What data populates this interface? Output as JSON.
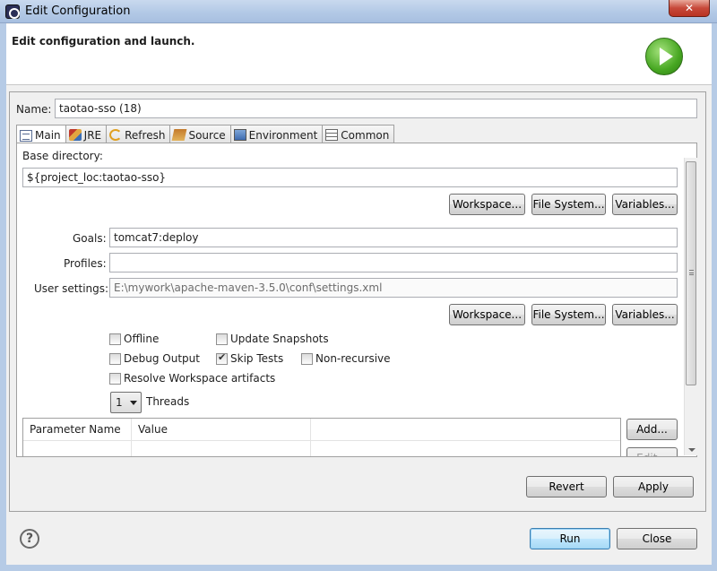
{
  "window": {
    "title": "Edit Configuration",
    "close_symbol": "✕"
  },
  "banner": {
    "text": "Edit configuration and launch."
  },
  "config": {
    "name_label": "Name:",
    "name_value": "taotao-sso (18)",
    "tabs": [
      {
        "label": "Main",
        "icon": "main-tab-icon"
      },
      {
        "label": "JRE",
        "icon": "jre-icon"
      },
      {
        "label": "Refresh",
        "icon": "refresh-icon"
      },
      {
        "label": "Source",
        "icon": "source-icon"
      },
      {
        "label": "Environment",
        "icon": "environment-icon"
      },
      {
        "label": "Common",
        "icon": "common-icon"
      }
    ],
    "base_directory_label": "Base directory:",
    "base_directory_value": "${project_loc:taotao-sso}",
    "buttons": {
      "workspace": "Workspace...",
      "file_system": "File System...",
      "variables": "Variables..."
    },
    "goals_label": "Goals:",
    "goals_value": "tomcat7:deploy",
    "profiles_label": "Profiles:",
    "profiles_value": "",
    "user_settings_label": "User settings:",
    "user_settings_value": "E:\\mywork\\apache-maven-3.5.0\\conf\\settings.xml",
    "checkboxes": {
      "offline": {
        "label": "Offline",
        "checked": false
      },
      "update_snapshots": {
        "label": "Update Snapshots",
        "checked": false
      },
      "debug_output": {
        "label": "Debug Output",
        "checked": false
      },
      "skip_tests": {
        "label": "Skip Tests",
        "checked": true
      },
      "non_recursive": {
        "label": "Non-recursive",
        "checked": false
      },
      "resolve_workspace": {
        "label": "Resolve Workspace artifacts",
        "checked": false
      }
    },
    "threads_value": "1",
    "threads_label": "Threads",
    "param_table": {
      "columns": [
        "Parameter Name",
        "Value"
      ],
      "add_label": "Add...",
      "edit_label": "Edit..."
    }
  },
  "footer": {
    "revert": "Revert",
    "apply": "Apply",
    "run": "Run",
    "close": "Close",
    "help_symbol": "?"
  }
}
